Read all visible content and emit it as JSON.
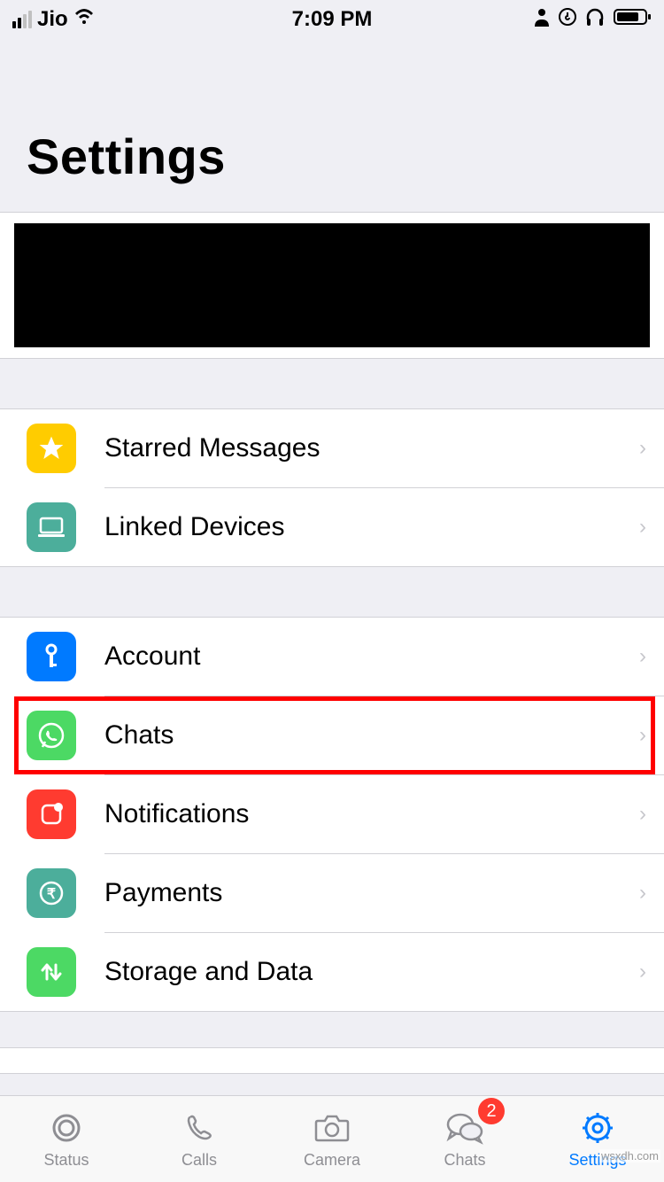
{
  "status_bar": {
    "carrier": "Jio",
    "time": "7:09 PM"
  },
  "page": {
    "title": "Settings"
  },
  "section1": [
    {
      "label": "Starred Messages",
      "icon": "star",
      "color": "#ffcc00"
    },
    {
      "label": "Linked Devices",
      "icon": "laptop",
      "color": "#4cae9b"
    }
  ],
  "section2": [
    {
      "label": "Account",
      "icon": "key",
      "color": "#007aff"
    },
    {
      "label": "Chats",
      "icon": "whatsapp",
      "color": "#4cd964",
      "highlighted": true
    },
    {
      "label": "Notifications",
      "icon": "notification",
      "color": "#ff3b30"
    },
    {
      "label": "Payments",
      "icon": "rupee",
      "color": "#4cae9b"
    },
    {
      "label": "Storage and Data",
      "icon": "arrows",
      "color": "#4cd964"
    }
  ],
  "tabs": [
    {
      "label": "Status",
      "icon": "status"
    },
    {
      "label": "Calls",
      "icon": "phone"
    },
    {
      "label": "Camera",
      "icon": "camera"
    },
    {
      "label": "Chats",
      "icon": "chats",
      "badge": "2"
    },
    {
      "label": "Settings",
      "icon": "gear",
      "active": true
    }
  ],
  "watermark": "wsxdh.com"
}
